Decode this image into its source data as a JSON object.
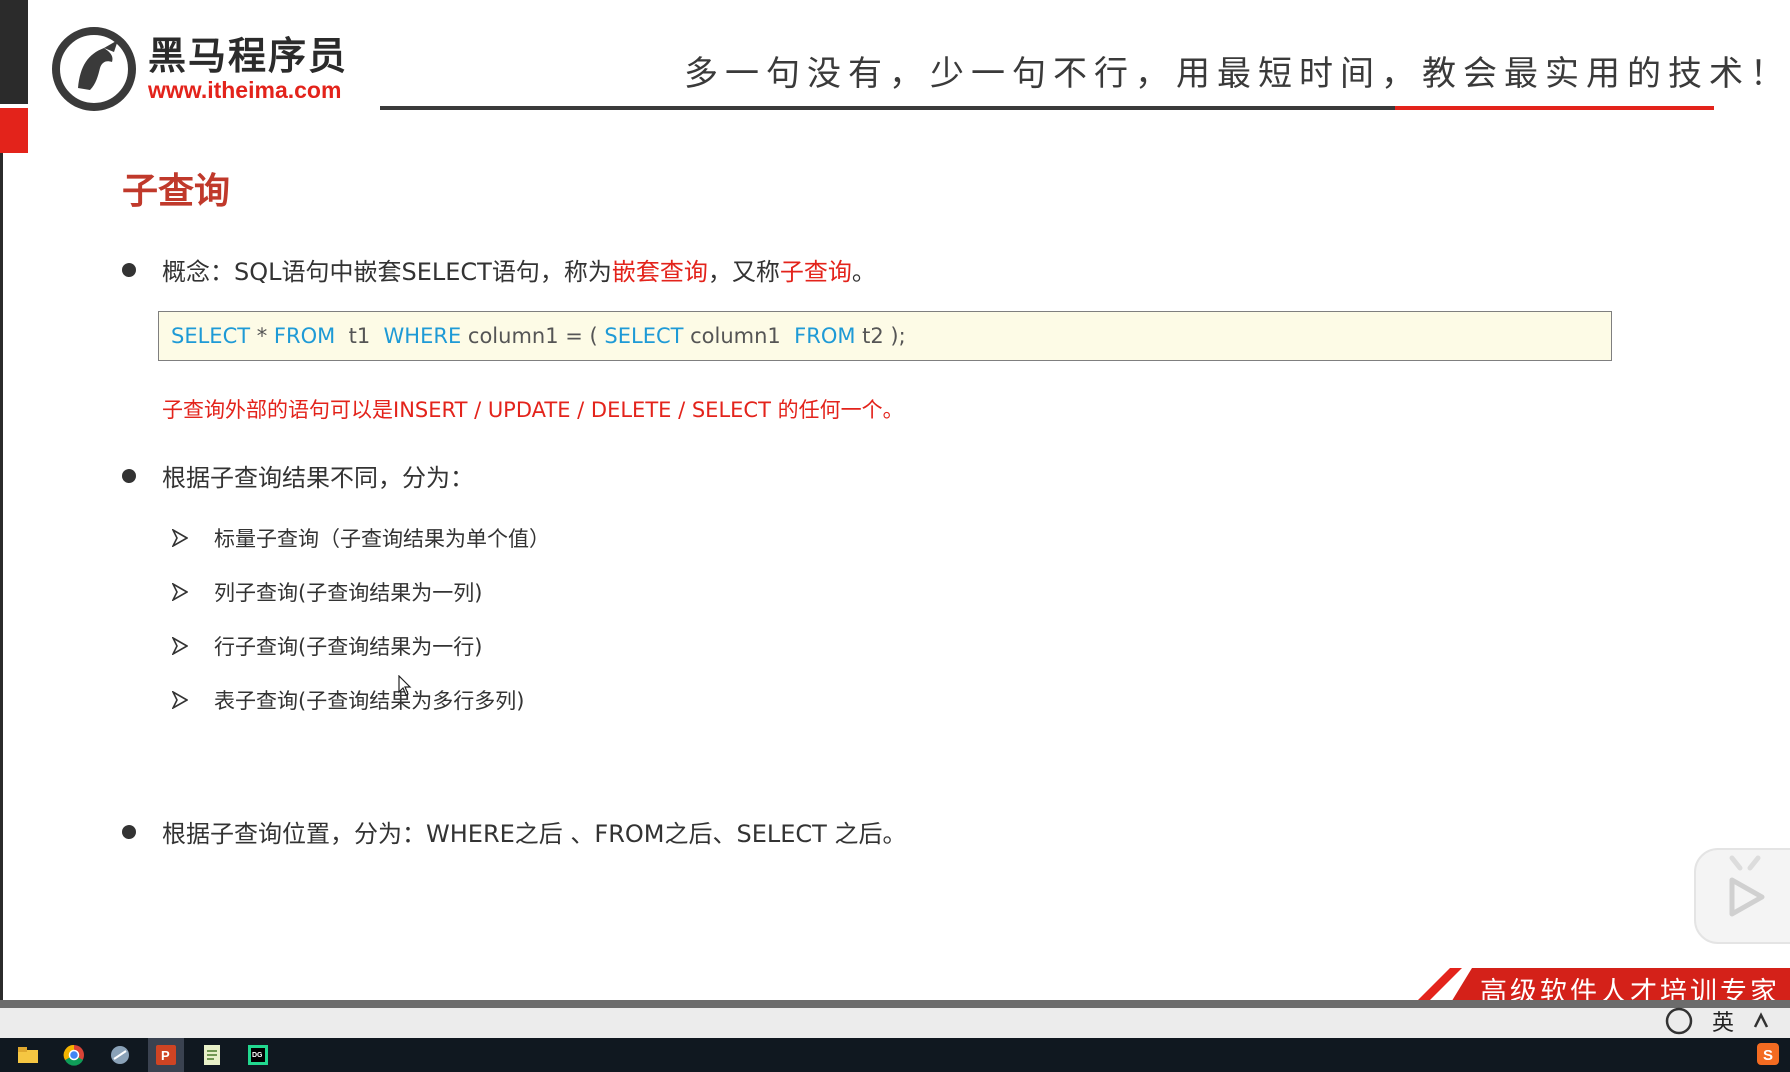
{
  "header": {
    "logo_cn": "黑马程序员",
    "logo_url": "www.itheima.com",
    "slogan": "多一句没有，少一句不行，用最短时间，教会最实用的技术！"
  },
  "slide": {
    "title": "子查询",
    "concept": {
      "prefix": "概念：SQL语句中嵌套SELECT语句，称为",
      "highlight1": "嵌套查询",
      "middle": "，又称",
      "highlight2": "子查询",
      "suffix": "。"
    },
    "code": {
      "kw_select1": "SELECT",
      "star": " * ",
      "kw_from1": "FROM",
      "t1": "  t1  ",
      "kw_where": "WHERE",
      "cond": " column1 = ( ",
      "kw_select2": "SELECT",
      "col": " column1  ",
      "kw_from2": "FROM",
      "t2": " t2 );"
    },
    "note": "子查询外部的语句可以是INSERT / UPDATE / DELETE / SELECT 的任何一个。",
    "classification_by_result": "根据子查询结果不同，分为：",
    "result_types": [
      "标量子查询（子查询结果为单个值）",
      "列子查询(子查询结果为一列)",
      "行子查询(子查询结果为一行)",
      "表子查询(子查询结果为多行多列)"
    ],
    "classification_by_position": "根据子查询位置，分为：WHERE之后 、FROM之后、SELECT 之后。",
    "banner": "高级软件人才培训专家"
  },
  "player": {
    "ime_label": "英"
  },
  "colors": {
    "accent_red": "#e3231b",
    "title_red": "#c0392b",
    "keyword_blue": "#1e9ad6",
    "code_bg": "#fdfbe6"
  },
  "taskbar_icons": [
    "file-explorer-icon",
    "chrome-icon",
    "app-icon",
    "powerpoint-icon",
    "notepad-icon",
    "datagrip-icon"
  ]
}
